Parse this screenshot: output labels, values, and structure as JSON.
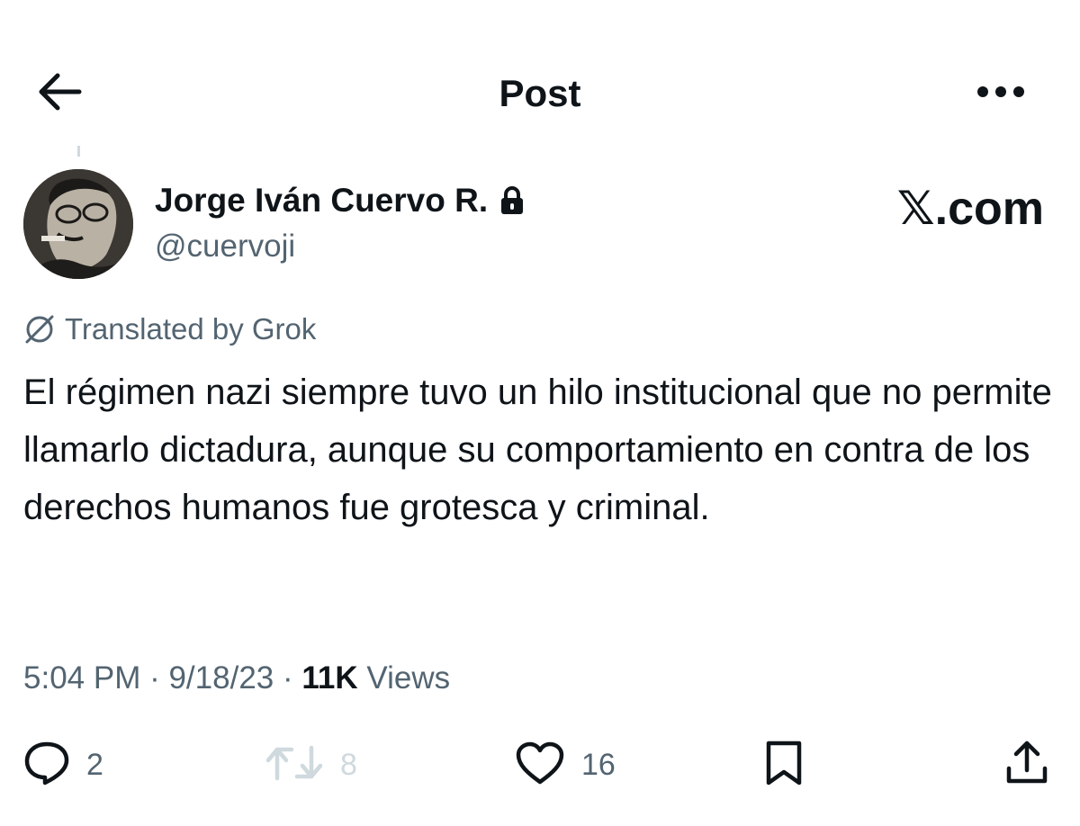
{
  "header": {
    "title": "Post",
    "back_icon": "arrow-left-icon",
    "more_icon": "more-dots-icon"
  },
  "author": {
    "name": "Jorge Iván Cuervo R.",
    "handle": "@cuervoji",
    "protected_icon": "lock-icon"
  },
  "watermark": "𝕏.com",
  "translation": {
    "label": "Translated by Grok",
    "icon": "grok-icon"
  },
  "post": {
    "text": "El régimen nazi siempre tuvo un hilo institucional que no permite llamarlo dictadura, aunque su comportamiento en contra de los derechos humanos fue grotesca y criminal."
  },
  "meta": {
    "time": "5:04 PM",
    "separator": " · ",
    "date": "9/18/23",
    "views_count": "11K",
    "views_label": "Views"
  },
  "actions": {
    "replies": "2",
    "reposts": "8",
    "likes": "16"
  },
  "colors": {
    "text_primary": "#0f1419",
    "text_secondary": "#536471",
    "disabled": "#cfd9de",
    "background": "#ffffff"
  }
}
